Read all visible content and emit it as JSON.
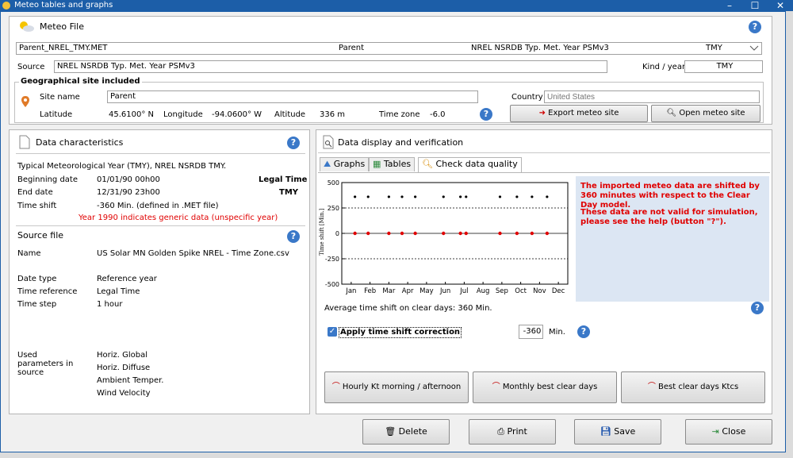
{
  "window": {
    "title": "Meteo tables and graphs",
    "minimize": "–",
    "maximize": "☐",
    "close": "✕"
  },
  "meteo_file": {
    "heading": "Meteo File",
    "file_name": "Parent_NREL_TMY.MET",
    "site": "Parent",
    "description": "NREL NSRDB Typ. Met. Year PSMv3",
    "kind": "TMY",
    "source_label": "Source",
    "source_value": "NREL NSRDB Typ. Met. Year PSMv3",
    "kind_year_label": "Kind / year",
    "kind_year_value": "TMY"
  },
  "geo": {
    "heading": "Geographical site included",
    "site_name_label": "Site name",
    "site_name_value": "Parent",
    "country_label": "Country",
    "country_placeholder": "United States",
    "latitude_label": "Latitude",
    "latitude_value": "45.6100° N",
    "longitude_label": "Longitude",
    "longitude_value": "-94.0600° W",
    "altitude_label": "Altitude",
    "altitude_value": "336 m",
    "timezone_label": "Time zone",
    "timezone_value": "-6.0",
    "export_button": "Export meteo site",
    "open_button": "Open meteo site"
  },
  "data_char": {
    "heading": "Data characteristics",
    "description": "Typical Meteorological Year (TMY), NREL NSRDB TMY.",
    "begin_label": "Beginning date",
    "begin_value": "01/01/90 00h00",
    "legal_time": "Legal Time",
    "end_label": "End date",
    "end_value": "12/31/90 23h00",
    "tmy": "TMY",
    "shift_label": "Time shift",
    "shift_value": "-360 Min. (defined in .MET file)",
    "warning": "Year 1990 indicates generic data (unspecific year)"
  },
  "source_file": {
    "heading": "Source file",
    "name_label": "Name",
    "name_value": "US Solar MN Golden Spike NREL - Time Zone.csv",
    "date_type_label": "Date type",
    "date_type_value": "Reference year",
    "time_ref_label": "Time reference",
    "time_ref_value": "Legal Time",
    "time_step_label": "Time step",
    "time_step_value": "1 hour",
    "used_label_1": "Used",
    "used_label_2": "parameters in",
    "used_label_3": "source",
    "params": [
      "Horiz. Global",
      "Horiz. Diffuse",
      "Ambient Temper.",
      "Wind Velocity"
    ]
  },
  "display": {
    "heading": "Data display and verification",
    "tabs": [
      "Graphs",
      "Tables",
      "Check data quality"
    ],
    "message_1": "The imported meteo data are shifted by 360 minutes with respect to the Clear Day model.",
    "message_2": "These data are not valid for simulation, please see the help (button \"?\").",
    "avg_shift": "Average time shift on clear days: 360 Min.",
    "apply_label": "Apply time shift correction",
    "apply_checked": true,
    "shift_value": "-360",
    "shift_unit": "Min.",
    "btn_hourly": "Hourly Kt morning / afternoon",
    "btn_monthly": "Monthly best clear days",
    "btn_best": "Best clear days Ktcs"
  },
  "chart_data": {
    "type": "scatter",
    "ylabel": "Time shift [Min.]",
    "ylim": [
      -500,
      500
    ],
    "yticks": [
      500,
      250,
      0,
      -250,
      -500
    ],
    "categories": [
      "Jan",
      "Feb",
      "Mar",
      "Apr",
      "May",
      "Jun",
      "Jul",
      "Aug",
      "Sep",
      "Oct",
      "Nov",
      "Dec"
    ],
    "grid": "dashed at ±250",
    "series": [
      {
        "color": "#000000",
        "x": [
          0.2,
          0.9,
          2.0,
          2.7,
          3.4,
          4.9,
          5.8,
          6.1,
          7.9,
          8.8,
          9.6,
          10.4
        ],
        "y": [
          360,
          360,
          360,
          360,
          360,
          360,
          360,
          360,
          360,
          360,
          360,
          360
        ]
      },
      {
        "color": "#e00000",
        "x": [
          0.2,
          0.9,
          2.0,
          2.7,
          3.4,
          4.9,
          5.8,
          6.1,
          7.9,
          8.8,
          9.6,
          10.4
        ],
        "y": [
          0,
          0,
          0,
          0,
          0,
          0,
          0,
          0,
          0,
          0,
          0,
          0
        ]
      }
    ]
  },
  "bottom": {
    "delete": "Delete",
    "print": "Print",
    "save": "Save",
    "close": "Close"
  }
}
